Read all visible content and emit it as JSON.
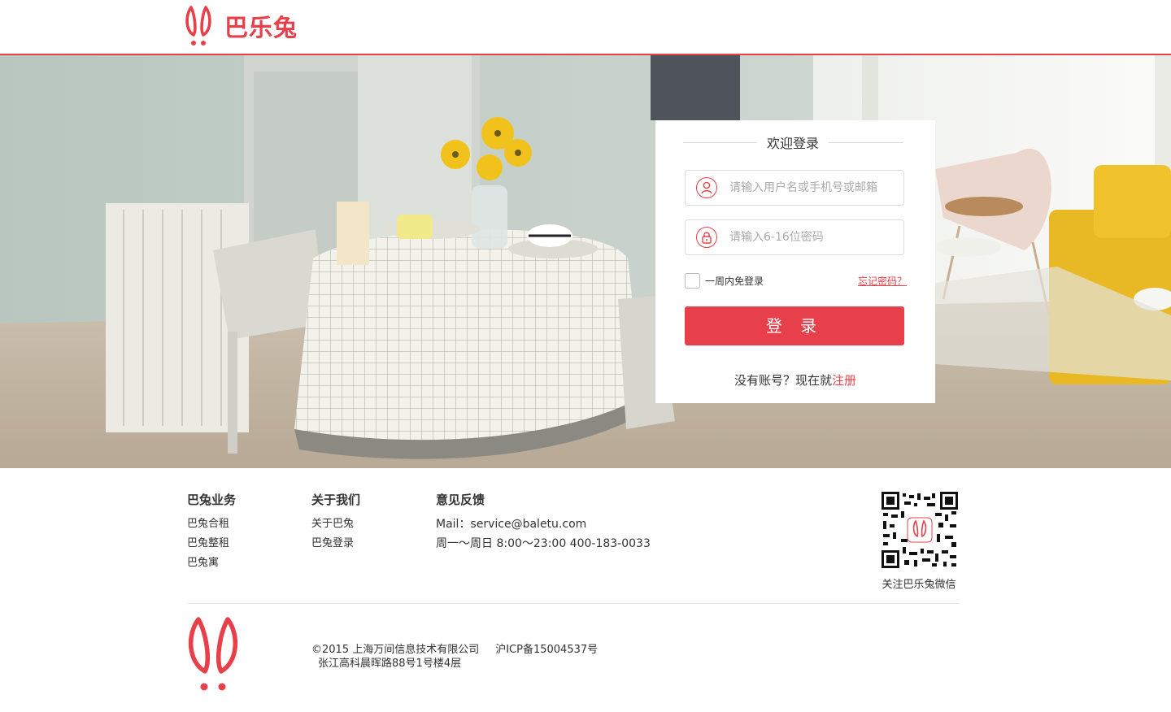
{
  "header": {
    "brand": "巴乐兔"
  },
  "login": {
    "title": "欢迎登录",
    "username_placeholder": "请输入用户名或手机号或邮箱",
    "password_placeholder": "请输入6-16位密码",
    "remember_label": "一周内免登录",
    "forgot_link": "忘记密码？",
    "submit_label": "登 录",
    "no_account_text": "没有账号？现在就",
    "register_link": "注册"
  },
  "footer": {
    "col1": {
      "title": "巴兔业务",
      "items": [
        "巴兔合租",
        "巴兔整租",
        "巴兔寓"
      ]
    },
    "col2": {
      "title": "关于我们",
      "items": [
        "关于巴兔",
        "巴兔登录"
      ]
    },
    "col3": {
      "title": "意见反馈",
      "mail": "Mail：service@baletu.com",
      "hours": "周一～周日 8:00～23:00 400-183-0033"
    },
    "qr_label": "关注巴乐兔微信",
    "copyright": "©2015 上海万间信息技术有限公司",
    "icp": "沪ICP备15004537号",
    "address": "张江高科晨晖路88号1号楼4层"
  },
  "colors": {
    "accent": "#e8404a"
  }
}
